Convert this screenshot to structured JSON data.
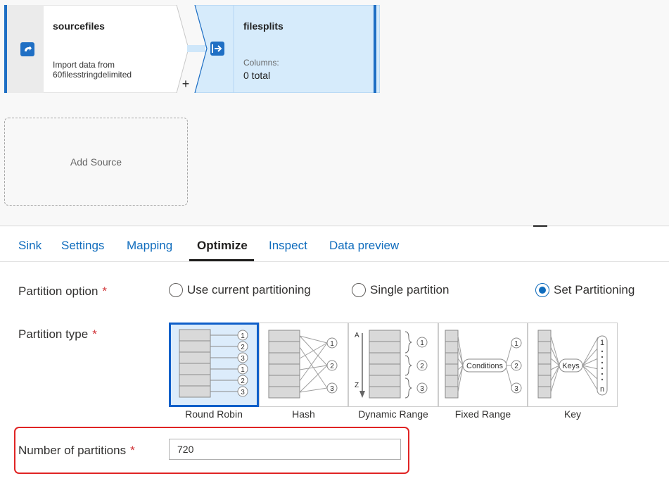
{
  "canvas": {
    "source_node": {
      "title": "sourcefiles",
      "subtitle_line1": "Import data from",
      "subtitle_line2": "60filesstringdelimited"
    },
    "sink_node": {
      "title": "filesplits",
      "caption": "Columns:",
      "value": "0 total"
    },
    "add_source_label": "Add Source",
    "plus_label": "+"
  },
  "tabs": [
    {
      "label": "Sink"
    },
    {
      "label": "Settings"
    },
    {
      "label": "Mapping"
    },
    {
      "label": "Optimize",
      "active": true
    },
    {
      "label": "Inspect"
    },
    {
      "label": "Data preview"
    }
  ],
  "form": {
    "partition_option": {
      "label": "Partition option",
      "required_mark": "*",
      "options": [
        {
          "label": "Use current partitioning",
          "checked": false
        },
        {
          "label": "Single partition",
          "checked": false
        },
        {
          "label": "Set Partitioning",
          "checked": true
        }
      ]
    },
    "partition_type": {
      "label": "Partition type",
      "required_mark": "*",
      "tiles": [
        {
          "label": "Round Robin",
          "selected": true,
          "marks": [
            "1",
            "2",
            "3",
            "1",
            "2",
            "3"
          ]
        },
        {
          "label": "Hash",
          "selected": false,
          "marks": [
            "1",
            "2",
            "3"
          ]
        },
        {
          "label": "Dynamic Range",
          "selected": false,
          "marks": [
            "1",
            "2",
            "3"
          ],
          "axis_top": "A",
          "axis_bottom": "Z"
        },
        {
          "label": "Fixed Range",
          "selected": false,
          "marks": [
            "1",
            "2",
            "3"
          ],
          "center": "Conditions"
        },
        {
          "label": "Key",
          "selected": false,
          "marks": [
            "1",
            "n"
          ],
          "center": "Keys"
        }
      ]
    },
    "num_partitions": {
      "label": "Number of partitions",
      "required_mark": "*",
      "value": "720"
    }
  },
  "colors": {
    "accent": "#0f6cbd",
    "selected_fill": "#dcecfb",
    "required": "#d13438",
    "highlight": "#e02424"
  },
  "icons": [
    "source-icon",
    "sink-icon"
  ]
}
